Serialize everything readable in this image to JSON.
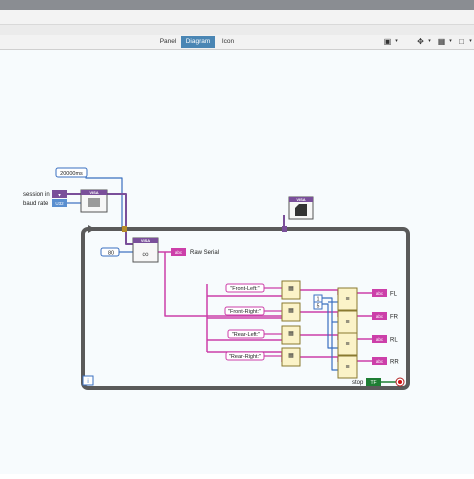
{
  "tabs": [
    {
      "label": "Panel"
    },
    {
      "label": "Diagram"
    },
    {
      "label": "Icon"
    }
  ],
  "toolbar_icons": [
    "cube-icon",
    "crosshair-icon",
    "align-icon",
    "square-icon"
  ],
  "diagram": {
    "timeout_const": "20000ms",
    "session_in_label": "session in",
    "baud_rate_label": "baud rate",
    "visa_label": "VISA",
    "byte_count_const": "80",
    "raw_serial_label": "Raw Serial",
    "strings": [
      "\"Front-Left:\"",
      "\"Front-Right:\"",
      "\"Rear-Left:\"",
      "\"Rear-Right:\""
    ],
    "index_consts": [
      "1",
      "5"
    ],
    "outputs": [
      "FL",
      "FR",
      "RL",
      "RR"
    ],
    "stop_label": "stop",
    "tf_label": "TF",
    "iteration_label": "i"
  },
  "colors": {
    "string_wire": "#cc3fa9",
    "visa_wire": "#7a4f9a",
    "numeric_wire": "#3a6fc0",
    "loop_border": "#5a5a5a",
    "active_tab": "#4a86b4"
  }
}
